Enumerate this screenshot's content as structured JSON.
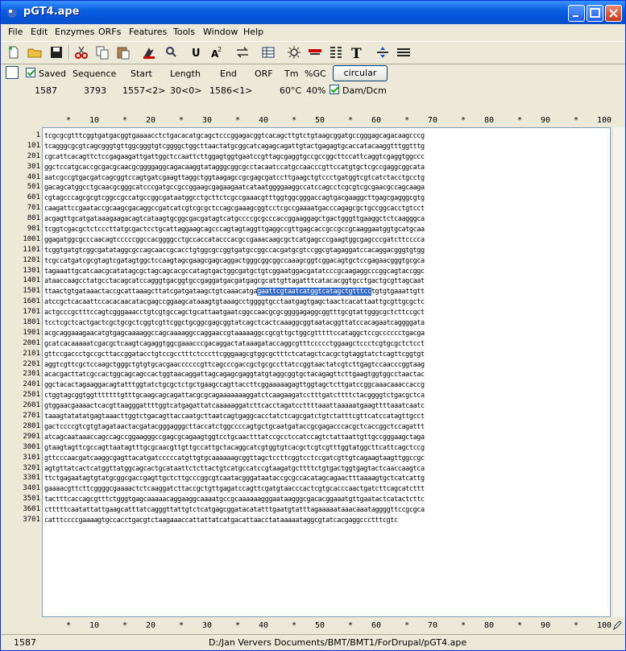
{
  "window": {
    "title": "pGT4.ape"
  },
  "menu": [
    "File",
    "Edit",
    "Enzymes",
    "ORFs",
    "Features",
    "Tools",
    "Window",
    "Help"
  ],
  "toolbar": {
    "icons": [
      "new-file-icon",
      "open-folder-icon",
      "save-icon",
      "cut-icon",
      "copy-icon",
      "paste-icon",
      "find-icon",
      "search-icon",
      "uppercase-icon",
      "case-toggle-icon",
      "reverse-complement-icon",
      "table-icon",
      "light-icon",
      "enzyme-map-icon",
      "alignment-icon",
      "text-icon",
      "translate-icon",
      "barcode-icon"
    ]
  },
  "info": {
    "saved_label": "Saved",
    "sequence_label": "Sequence",
    "start_label": "Start",
    "length_label": "Length",
    "end_label": "End",
    "orf_label": "ORF",
    "tm_label": "Tm",
    "gc_label": "%GC",
    "circular_button": "circular",
    "saved_value": "1587",
    "sequence_value": "3793",
    "start_value": "1557<2>",
    "length_value": "30<0>",
    "end_value": "1586<1>",
    "tm_value": "60°C",
    "gc_value": "40%",
    "damdcm_label": "Dam/Dcm"
  },
  "ruler": [
    "*",
    "10",
    "*",
    "20",
    "*",
    "30",
    "*",
    "40",
    "*",
    "50",
    "*",
    "60",
    "*",
    "70",
    "*",
    "80",
    "*",
    "90",
    "*",
    "100"
  ],
  "line_numbers": [
    "1",
    "101",
    "201",
    "301",
    "401",
    "501",
    "601",
    "701",
    "801",
    "901",
    "1001",
    "1101",
    "1201",
    "1301",
    "1401",
    "1501",
    "1601",
    "1701",
    "1801",
    "1901",
    "2001",
    "2101",
    "2201",
    "2301",
    "2401",
    "2501",
    "2601",
    "2701",
    "2801",
    "2901",
    "3001",
    "3101",
    "3201",
    "3301",
    "3401",
    "3501",
    "3601",
    "3701"
  ],
  "sequence_lines": [
    "tcgcgcgtttcggtgatgacggtgaaaacctctgacacatgcagctcccggagacggtcacagcttgtctgtaagcggatgccgggagcagacaagcccg",
    "tcagggcgcgtcagcgggtgttggcgggtgtcggggctggcttaactatgcggcatcagagcagattgtactgagagtgcaccatacaaggtttggtttg",
    "cgcattcacagttctccgagaagattgattggctccaattcttggagtggtgaatccgttagcgaggtgccgccggcttccattcaggtcgaggtggccc",
    "ggctccatgcaccgcgacgcaacgcggggaggcagacaaggtatagggcggcgcctacaatccatgccaacccgttccatgtgctcgccgaggcggcata",
    "aatcgccgtgacgatcagcggtccagtgatcgaagttaggctggtaagagccgcgagcgatccttgaagctgtccctgatggtcgtcatctacctgcctg",
    "gacagcatggcctgcaacgcgggcatcccgatgccgccggaagcgagaagaatcataatggggaaggccatccagcctcgcgtcgcgaacgccagcaaga",
    "cgtagcccagcgcgtcggccgccatgccggcgataatggcctgcttctcgccgaaacgtttggtggcgggaccagtgacgaaggcttgagcgagggcgtg",
    "caagattccgaataccgcaagcgacaggccgatcatcgtcgcgctccagcgaaagcggtcctcgccgaaaatgacccagagcgctgccggcacctgtcct",
    "acgagttgcatgataaagaagacagtcataagtgcggcgacgatagtcatgccccgcgcccaccggaaggagctgactgggttgaaggctctcaagggca",
    "tcggtcgacgctctcccttatgcgactcctgcattaggaagcagcccagtagtaggttgaggccgttgagcaccgccgccgcaaggaatggtgcatgcaa",
    "ggagatggcgcccaacagtcccccggccacggggcctgccaccatacccacgccgaaacaagcgctcatgagcccgaagtggcgagcccgatcttcccca",
    "tcggtgatgtcggcgatataggcgccagcaaccgcacctgtggcgccggtgatgccggccacgatgcgtccggcgtagaggatccacaggacgggtgtgg",
    "tcgccatgatcgcgtagtcgatagtggctccaagtagcgaagcgagcaggactgggcggcggccaaagcggtcggacagtgctccgagaacgggtgcgca",
    "tagaaattgcatcaacgcatatagcgctagcagcacgccatagtgactggcgatgctgtcggaatggacgatatcccgcaagaggcccggcagtaccggc",
    "ataaccaagcctatgcctacagcatccagggtgacggtgccgaggatgacgatgagcgcattgttagatttcatacacggtgcctgactgcgttagcaat",
    "ttaactgtgataaactaccgcattaaagcttatcgatgataagctgtcaaacatgagaattcgtaatcatggtcatagctgtttcctgtgtgaaattgtt",
    "atccgctcacaattccacacaacatacgagccggaagcataaagtgtaaagcctggggtgcctaatgagtgagctaactcacattaattgcgttgcgctc",
    "actgcccgctttccagtcgggaaacctgtcgtgccagctgcattaatgaatcggccaacgcgcggggagaggcggtttgcgtattgggcgctcttccgct",
    "tcctcgctcactgactcgctgcgctcggtcgttcggctgcggcgagcggtatcagctcactcaaaggcggtaatacggttatccacagaatcaggggata",
    "acgcaggaaagaacatgtgagcaaaaggccagcaaaaggccaggaaccgtaaaaaggccgcgttgctggcgtttttccataggctccgcccccctgacga",
    "gcatcacaaaaatcgacgctcaagtcagaggtggcgaaacccgacaggactataaagataccaggcgtttccccctggaagctccctcgtgcgctctcct",
    "gttccgaccctgccgcttaccggatacctgtccgcctttctcccttcgggaagcgtggcgctttctcatagctcacgctgtaggtatctcagttcggtgt",
    "aggtcgttcgctccaagctgggctgtgtgcacgaaccccccgttcagcccgaccgctgcgccttatccggtaactatcgtcttgagtccaacccggtaag",
    "acacgacttatcgccactggcagcagccactggtaacaggattagcagagcgaggtatgtaggcggtgctacagagttcttgaagtggtggcctaactac",
    "ggctacactagaaggacagtatttggtatctgcgctctgctgaagccagttaccttcggaaaaagagttggtagctcttgatccggcaaacaaaccaccg",
    "ctggtagcggtggtttttttgtttgcaagcagcagattacgcgcagaaaaaaaggatctcaagaagatcctttgatcttttctacggggtctgacgctca",
    "gtggaacgaaaactcacgttaagggattttggtcatgagattatcaaaaaggatcttcacctagatccttttaaattaaaaatgaagttttaaatcaatc",
    "taaagtatatatgagtaaacttggtctgacagttaccaatgcttaatcagtgaggcacctatctcagcgatctgtctatttcgttcatccatagttgcct",
    "gactccccgtcgtgtagataactacgatacgggagggcttaccatctggccccagtgctgcaatgataccgcgagacccacgctcaccggctccagattt",
    "atcagcaataaaccagccagccggaagggccgagcgcagaagtggtcctgcaactttatccgcctccatccagtctattaattgttgccgggaagctaga",
    "gtaagtagttcgccagttaatagtttgcgcaacgttgttgccattgctacaggcatcgtggtgtcacgctcgtcgtttggtatggcttcattcagctccg",
    "gttcccaacgatcaaggcgagttacatgatcccccatgttgtgcaaaaaagcggttagctccttcggtcctccgatcgttgtcagaagtaagttggccgc",
    "agtgttatcactcatggttatggcagcactgcataattctcttactgtcatgccatccgtaagatgcttttctgtgactggtgagtactcaaccaagtca",
    "ttctgagaatagtgtatgcggcgaccgagttgctcttgcccggcgtcaatacgggataataccgcgccacatagcagaactttaaaagtgctcatcattg",
    "gaaaacgttcttcggggcgaaaactctcaaggatcttaccgctgttgagatccagttcgatgtaacccactcgtgcacccaactgatcttcagcatcttt",
    "tactttcaccagcgtttctgggtgagcaaaaacaggaaggcaaaatgccgcaaaaaagggaataagggcgacacggaaatgttgaatactcatactcttc",
    "ctttttcaatattattgaagcatttatcagggttattgtctcatgagcggatacatatttgaatgtatttagaaaaataaacaaataggggttccgcgca",
    "catttccccgaaaagtgccacctgacgtctaagaaaccattattatcatgacattaacctataaaaataggcgtatcacgaggccctttcgtc"
  ],
  "highlight": {
    "line_index": 15,
    "text": "gaattcgtaatcatggtcatagctgtttcc"
  },
  "status": {
    "position": "1587",
    "path": "D:/Jan Ververs  Documents/BMT/BMT1/ForDrupal/pGT4.ape"
  }
}
